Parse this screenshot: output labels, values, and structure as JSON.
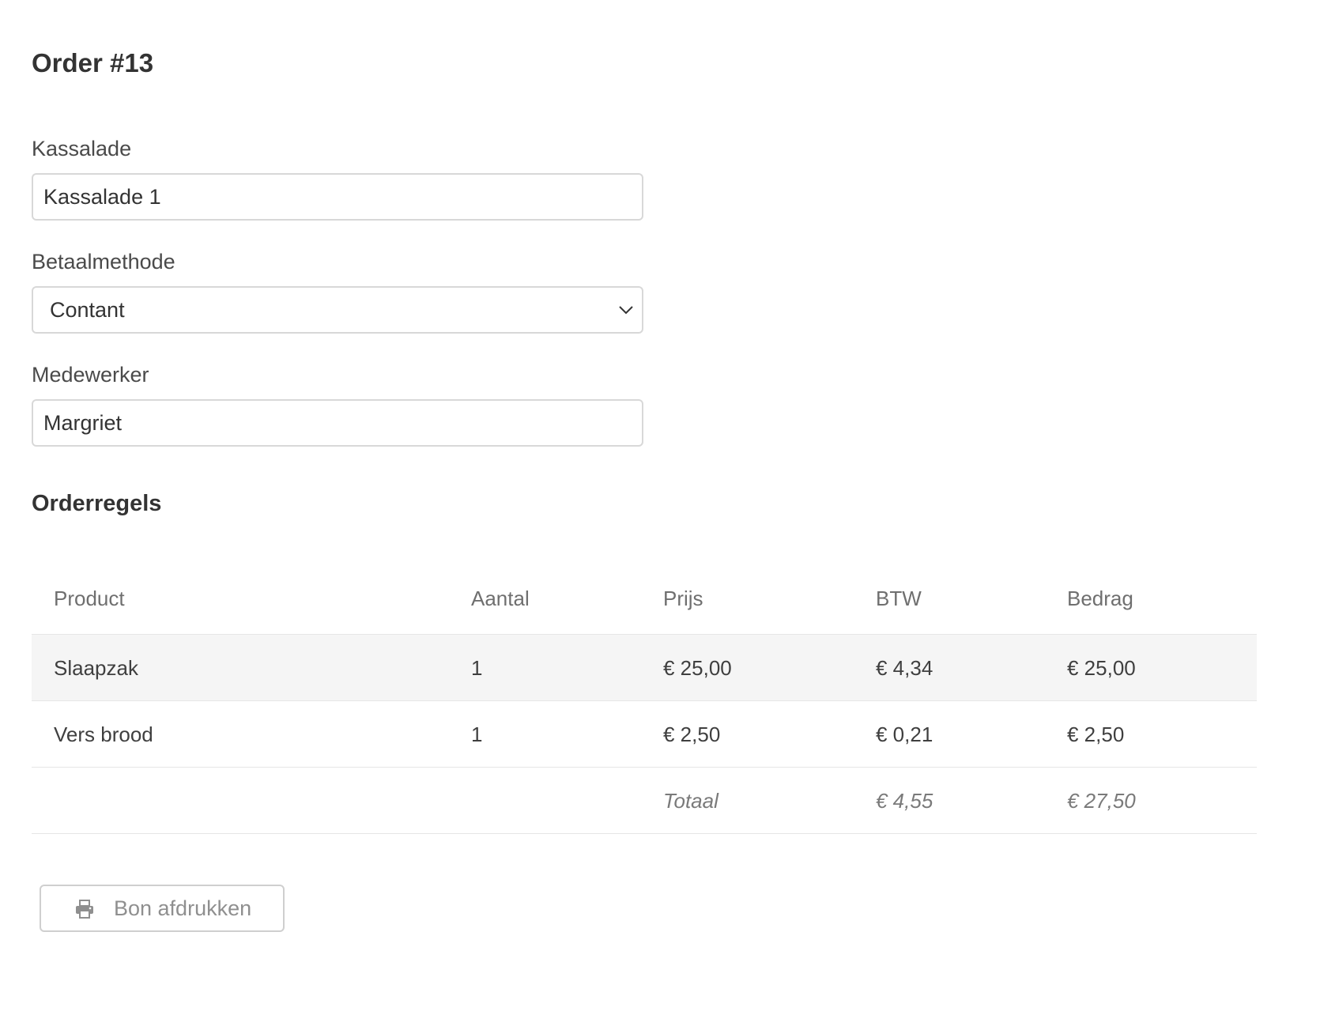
{
  "order": {
    "title": "Order #13"
  },
  "form": {
    "register_label": "Kassalade",
    "register_value": "Kassalade 1",
    "payment_label": "Betaalmethode",
    "payment_value": "Contant",
    "employee_label": "Medewerker",
    "employee_value": "Margriet"
  },
  "orderlines": {
    "title": "Orderregels",
    "columns": [
      "Product",
      "Aantal",
      "Prijs",
      "BTW",
      "Bedrag"
    ],
    "rows": [
      {
        "product": "Slaapzak",
        "quantity": "1",
        "price": "€ 25,00",
        "vat": "€ 4,34",
        "amount": "€ 25,00"
      },
      {
        "product": "Vers brood",
        "quantity": "1",
        "price": "€ 2,50",
        "vat": "€ 0,21",
        "amount": "€ 2,50"
      }
    ],
    "total": {
      "label": "Totaal",
      "vat": "€ 4,55",
      "amount": "€ 27,50"
    }
  },
  "actions": {
    "print_label": "Bon afdrukken",
    "print_icon": "printer-icon"
  }
}
